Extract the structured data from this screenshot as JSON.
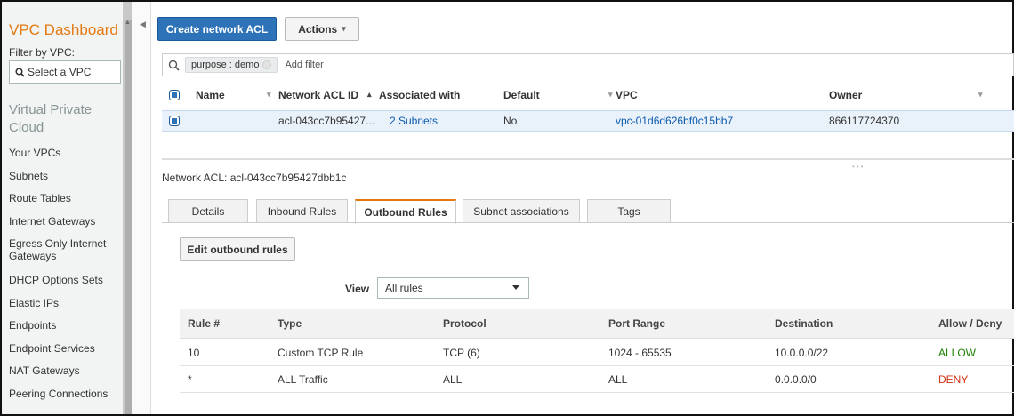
{
  "sidebar": {
    "title": "VPC Dashboard",
    "filter_label": "Filter by VPC:",
    "select_placeholder": "Select a VPC",
    "section": "Virtual Private Cloud",
    "items": [
      "Your VPCs",
      "Subnets",
      "Route Tables",
      "Internet Gateways",
      "Egress Only Internet Gateways",
      "DHCP Options Sets",
      "Elastic IPs",
      "Endpoints",
      "Endpoint Services",
      "NAT Gateways",
      "Peering Connections"
    ]
  },
  "toolbar": {
    "create_label": "Create network ACL",
    "actions_label": "Actions"
  },
  "filter": {
    "token": "purpose : demo",
    "add_label": "Add filter"
  },
  "table": {
    "headers": [
      "Name",
      "Network ACL ID",
      "Associated with",
      "Default",
      "VPC",
      "Owner"
    ],
    "rows": [
      {
        "name": "",
        "acl_id": "acl-043cc7b95427...",
        "associated": "2 Subnets",
        "default": "No",
        "vpc": "vpc-01d6d626bf0c15bb7",
        "owner": "866117724370"
      }
    ]
  },
  "details": {
    "title": "Network ACL: acl-043cc7b95427dbb1c",
    "tabs": [
      "Details",
      "Inbound Rules",
      "Outbound Rules",
      "Subnet associations",
      "Tags"
    ],
    "active_tab": "Outbound Rules",
    "edit_button": "Edit outbound rules",
    "view_label": "View",
    "view_value": "All rules",
    "rules_headers": [
      "Rule #",
      "Type",
      "Protocol",
      "Port Range",
      "Destination",
      "Allow / Deny"
    ],
    "rules": [
      {
        "rule": "10",
        "type": "Custom TCP Rule",
        "protocol": "TCP (6)",
        "port": "1024 - 65535",
        "dest": "10.0.0.0/22",
        "action": "ALLOW"
      },
      {
        "rule": "*",
        "type": "ALL Traffic",
        "protocol": "ALL",
        "port": "ALL",
        "dest": "0.0.0.0/0",
        "action": "DENY"
      }
    ]
  },
  "colors": {
    "accent_orange": "#e47911",
    "primary_blue": "#2e73b8",
    "link_blue": "#0b5aad",
    "allow_green": "#1d8102",
    "deny_red": "#d13212"
  }
}
